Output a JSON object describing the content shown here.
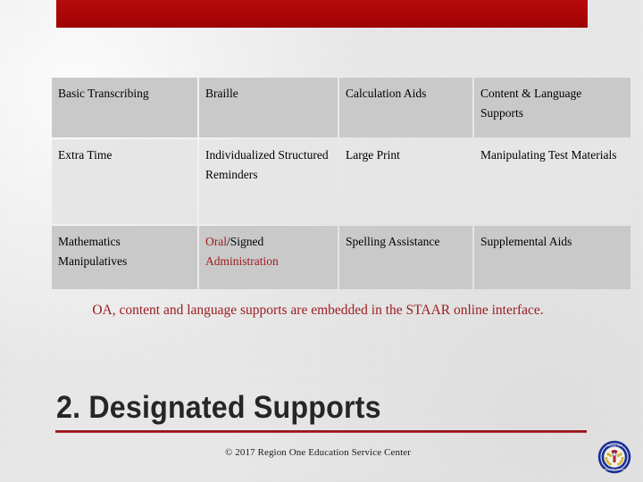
{
  "slide": {
    "background_color": "#ebebeb",
    "accent_color": "#9c1c20",
    "bar_color": "#ab0606"
  },
  "table": {
    "rows": [
      {
        "shaded": true,
        "cells": [
          {
            "text": "Basic Transcribing",
            "color": "black"
          },
          {
            "text": "Braille",
            "color": "black"
          },
          {
            "text": "Calculation Aids",
            "color": "black"
          },
          {
            "text": "Content & Language Supports",
            "color": "accent"
          }
        ]
      },
      {
        "shaded": false,
        "cells": [
          {
            "text": "Extra Time",
            "color": "black"
          },
          {
            "text": "Individualized Structured Reminders",
            "color": "black"
          },
          {
            "text": "Large Print",
            "color": "black"
          },
          {
            "text": "Manipulating Test Materials",
            "color": "black"
          }
        ]
      },
      {
        "shaded": true,
        "cells": [
          {
            "text": "Mathematics Manipulatives",
            "color": "black"
          },
          {
            "text": "",
            "color": "mixed",
            "parts": [
              {
                "text": "Oral",
                "color": "accent"
              },
              {
                "text": "/Signed",
                "color": "black"
              },
              {
                "text": " ",
                "color": "black"
              },
              {
                "text": "Administration",
                "color": "accent"
              }
            ]
          },
          {
            "text": "Spelling Assistance",
            "color": "black"
          },
          {
            "text": "Supplemental Aids",
            "color": "black"
          }
        ]
      }
    ]
  },
  "caption": {
    "text": "OA, content and language supports are embedded in the STAAR online interface."
  },
  "heading": {
    "text": "2. Designated Supports"
  },
  "footer": {
    "copyright": "© 2017 Region One Education Service Center",
    "logo_name": "region-one-seal"
  }
}
